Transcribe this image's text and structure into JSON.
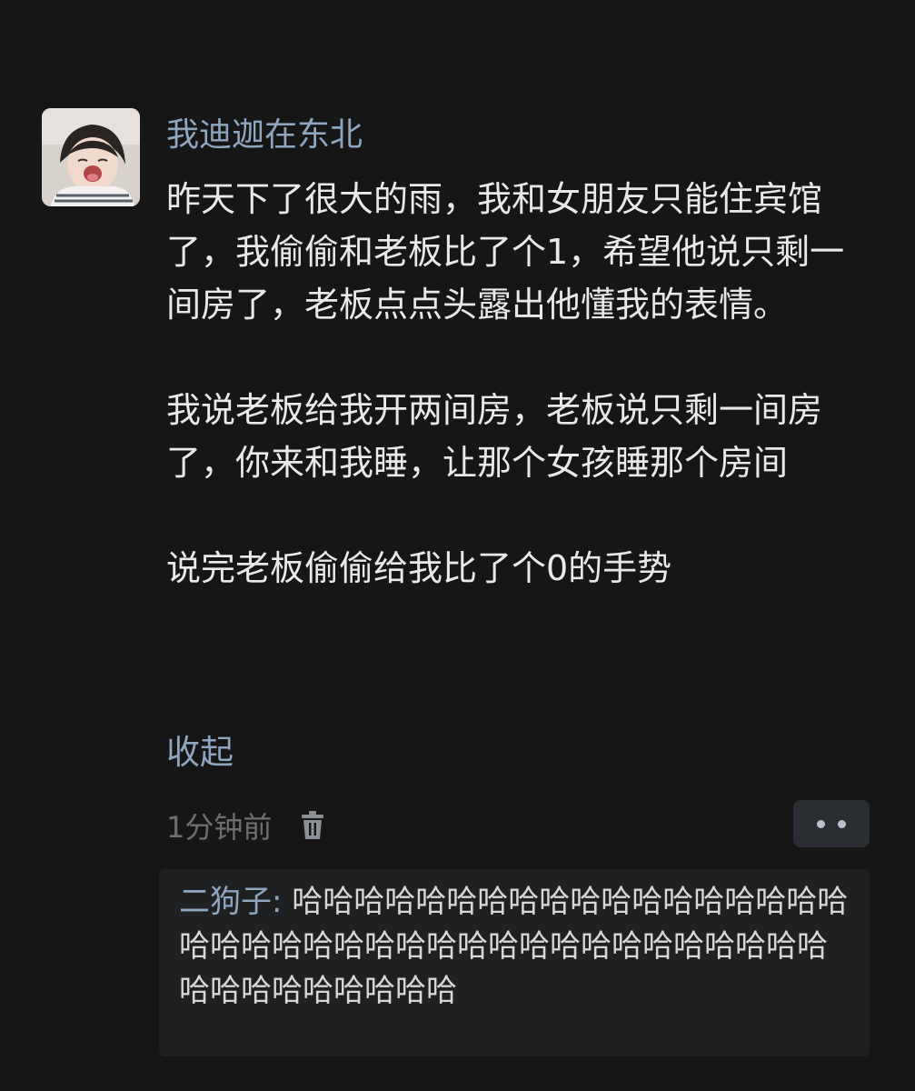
{
  "post": {
    "username": "我迪迦在东北",
    "paragraphs": [
      "昨天下了很大的雨，我和女朋友只能住宾馆了，我偷偷和老板比了个1，希望他说只剩一间房了，老板点点头露出他懂我的表情。",
      "我说老板给我开两间房，老板说只剩一间房了，你来和我睡，让那个女孩睡那个房间",
      "说完老板偷偷给我比了个0的手势"
    ],
    "collapse_label": "收起",
    "timestamp": "1分钟前",
    "delete_icon": "trash-icon",
    "more_icon": "more-dots-icon"
  },
  "reply": {
    "author": "二狗子",
    "separator": ": ",
    "text": "哈哈哈哈哈哈哈哈哈哈哈哈哈哈哈哈哈哈哈哈哈哈哈哈哈哈哈哈哈哈哈哈哈哈哈哈哈哈哈哈哈哈哈哈哈哈哈哈"
  },
  "colors": {
    "background": "#161616",
    "link": "#8fa6c0",
    "body_text": "#e9e9e9",
    "muted": "#6f6f6f",
    "reply_bg": "#1f2021"
  }
}
